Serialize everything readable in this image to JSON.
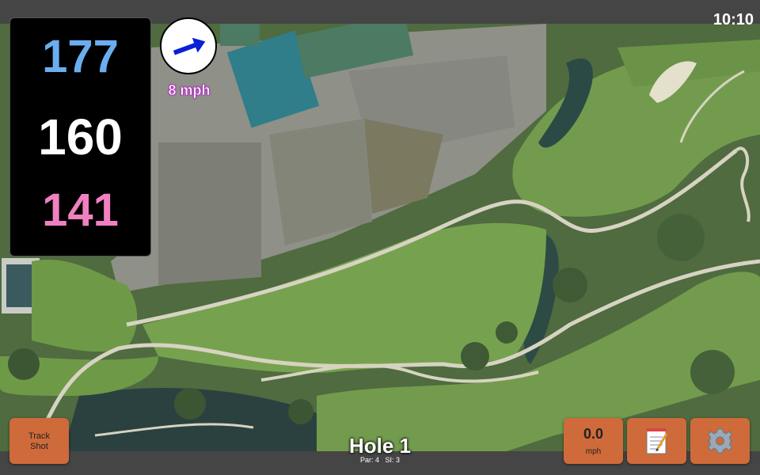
{
  "status_bar": {
    "time": "10:10"
  },
  "distances": {
    "back": "177",
    "middle": "160",
    "front": "141",
    "back_color": "#6aaef0",
    "middle_color": "#ffffff",
    "front_color": "#f080c0"
  },
  "wind": {
    "speed_label": "8 mph",
    "direction_icon": "arrow-right-up-icon",
    "arrow_color": "#0a1fd6"
  },
  "track_shot": {
    "line1": "Track",
    "line2": "Shot"
  },
  "speed_button": {
    "value": "0.0",
    "unit": "mph"
  },
  "scorecard_button": {
    "icon": "notepad-icon"
  },
  "settings_button": {
    "icon": "gear-icon"
  },
  "hole": {
    "title": "Hole 1",
    "par": "Par: 4",
    "si": "SI: 3"
  },
  "colors": {
    "button": "#cf6a3a",
    "bars": "#454545",
    "fairway": "#6f9a4c"
  }
}
